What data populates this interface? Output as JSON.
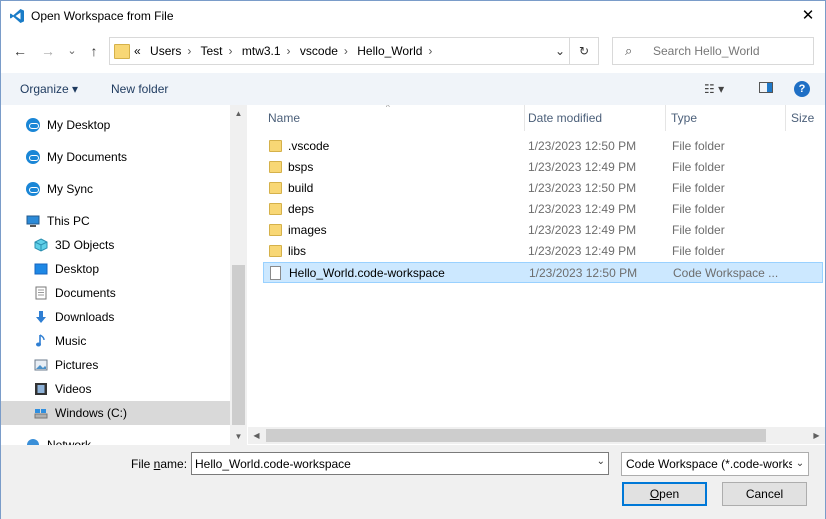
{
  "window": {
    "title": "Open Workspace from File",
    "close_glyph": "✕"
  },
  "nav": {
    "back": "←",
    "forward": "→",
    "recent": "⌄",
    "up": "↑",
    "breadcrumb": [
      "«",
      "Users",
      "Test",
      "mtw3.1",
      "vscode",
      "Hello_World"
    ],
    "separator": "›",
    "dropdown": "⌄",
    "refresh": "↻",
    "search_placeholder": "Search Hello_World",
    "search_icon": "⌕"
  },
  "toolbar": {
    "organize": "Organize ▾",
    "new_folder": "New folder",
    "view_icon": "☷ ▾",
    "help": "?"
  },
  "sidebar": {
    "items": [
      {
        "label": "My Desktop",
        "icon": "cloud-icon"
      },
      {
        "label": "My Documents",
        "icon": "cloud-icon"
      },
      {
        "label": "My Sync",
        "icon": "cloud-icon"
      },
      {
        "label": "This PC",
        "icon": "computer-icon"
      },
      {
        "label": "3D Objects",
        "icon": "cube-icon"
      },
      {
        "label": "Desktop",
        "icon": "desktop-icon"
      },
      {
        "label": "Documents",
        "icon": "documents-icon"
      },
      {
        "label": "Downloads",
        "icon": "download-icon"
      },
      {
        "label": "Music",
        "icon": "music-icon"
      },
      {
        "label": "Pictures",
        "icon": "pictures-icon"
      },
      {
        "label": "Videos",
        "icon": "videos-icon"
      },
      {
        "label": "Windows (C:)",
        "icon": "drive-icon"
      },
      {
        "label": "Network",
        "icon": "network-icon"
      }
    ],
    "scroll_up": "▲",
    "scroll_down": "▼"
  },
  "columns": {
    "name": "Name",
    "date": "Date modified",
    "type": "Type",
    "size": "Size",
    "sort_glyph": "^"
  },
  "files": [
    {
      "name": ".vscode",
      "date": "1/23/2023 12:50 PM",
      "type": "File folder",
      "kind": "folder"
    },
    {
      "name": "bsps",
      "date": "1/23/2023 12:49 PM",
      "type": "File folder",
      "kind": "folder"
    },
    {
      "name": "build",
      "date": "1/23/2023 12:50 PM",
      "type": "File folder",
      "kind": "folder"
    },
    {
      "name": "deps",
      "date": "1/23/2023 12:49 PM",
      "type": "File folder",
      "kind": "folder"
    },
    {
      "name": "images",
      "date": "1/23/2023 12:49 PM",
      "type": "File folder",
      "kind": "folder"
    },
    {
      "name": "libs",
      "date": "1/23/2023 12:49 PM",
      "type": "File folder",
      "kind": "folder"
    },
    {
      "name": "Hello_World.code-workspace",
      "date": "1/23/2023 12:50 PM",
      "type": "Code Workspace ...",
      "kind": "doc"
    }
  ],
  "hscroll": {
    "left": "◀",
    "right": "▶"
  },
  "footer": {
    "file_name_label_pre": "File ",
    "file_name_label_u": "n",
    "file_name_label_post": "ame:",
    "file_name_value": "Hello_World.code-workspace",
    "filter_value": "Code Workspace (*.code-workspace)",
    "dropdown": "⌄",
    "open_u": "O",
    "open_rest": "pen",
    "cancel": "Cancel"
  },
  "colors": {
    "accent": "#0078d7",
    "selection": "#cce8ff",
    "folder": "#f8d775"
  }
}
